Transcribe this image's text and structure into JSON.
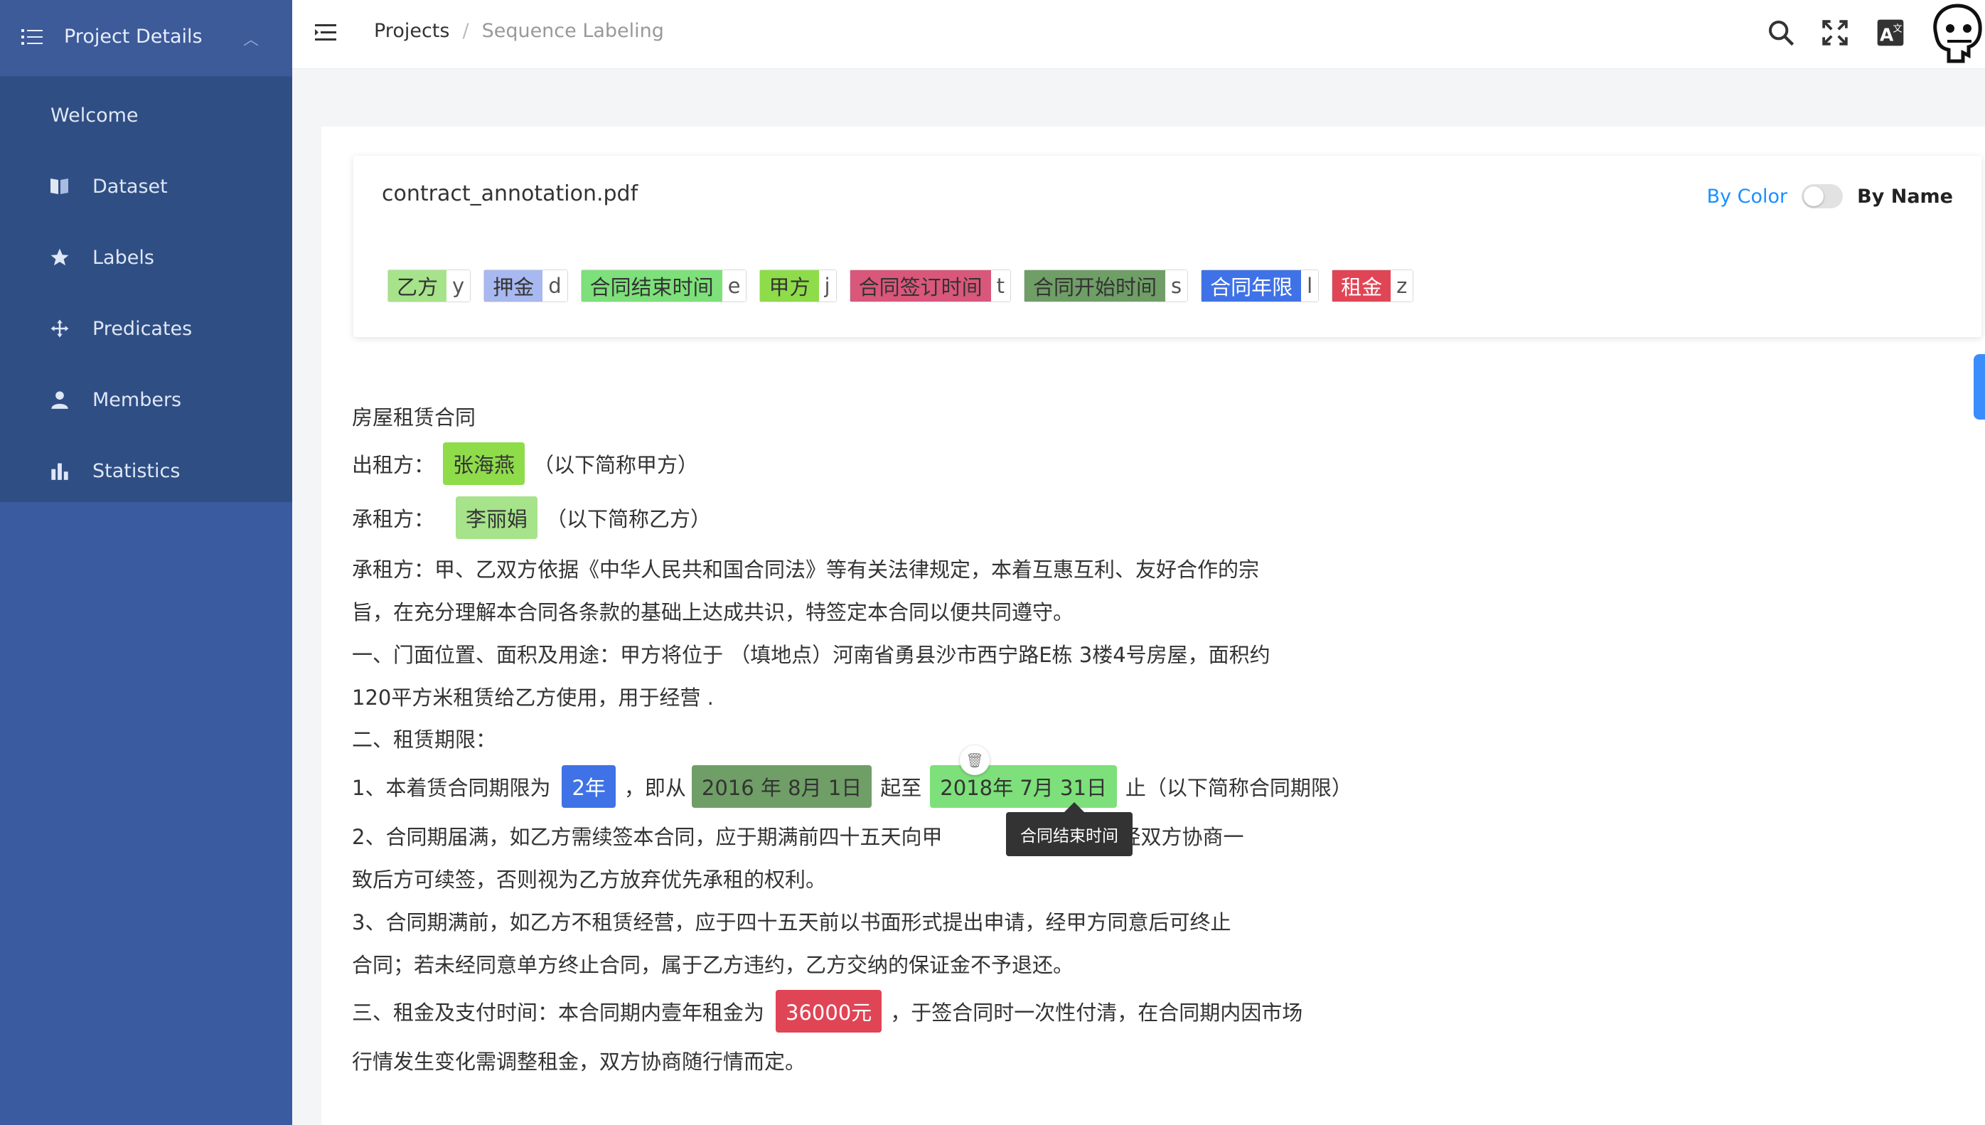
{
  "sidebar": {
    "title": "Project Details",
    "items": [
      {
        "label": "Welcome"
      },
      {
        "label": "Dataset"
      },
      {
        "label": "Labels"
      },
      {
        "label": "Predicates"
      },
      {
        "label": "Members"
      },
      {
        "label": "Statistics"
      }
    ]
  },
  "header": {
    "breadcrumb": [
      "Projects",
      "/",
      "Sequence Labeling"
    ]
  },
  "labels_card": {
    "filename": "contract_annotation.pdf",
    "toggle_left": "By Color",
    "toggle_right": "By Name",
    "labels": [
      {
        "name": "乙方",
        "key": "y",
        "color": "#a6e38a"
      },
      {
        "name": "押金",
        "key": "d",
        "color": "#a8b8f0"
      },
      {
        "name": "合同结束时间",
        "key": "e",
        "color": "#7de07a"
      },
      {
        "name": "甲方",
        "key": "j",
        "color": "#8fdc4a"
      },
      {
        "name": "合同签订时间",
        "key": "t",
        "color": "#d9577a"
      },
      {
        "name": "合同开始时间",
        "key": "s",
        "color": "#6f9e66"
      },
      {
        "name": "合同年限",
        "key": "l",
        "color": "#3f72e6"
      },
      {
        "name": "租金",
        "key": "z",
        "color": "#e04556"
      }
    ]
  },
  "doc": {
    "l1": "房屋租赁合同",
    "l2a": "出租方：",
    "l2e": "张海燕",
    "l2b": "（以下简称甲方）",
    "l3a": "承租方：",
    "l3e": "李丽娟",
    "l3b": "（以下简称乙方）",
    "l4": "承租方：甲、乙双方依据《中华人民共和国合同法》等有关法律规定，本着互惠互利、友好合作的宗",
    "l5": "旨，在充分理解本合同各条款的基础上达成共识，特签定本合同以便共同遵守。",
    "l6": "一、门面位置、面积及用途：甲方将位于 （填地点）河南省勇县沙市西宁路E栋 3楼4号房屋，面积约",
    "l7": "120平方米租赁给乙方使用，用于经营 .",
    "l8": "二、租赁期限：",
    "l9a": "1、本着赁合同期限为",
    "l9e1": "2年",
    "l9b": "，即从",
    "l9e2": "2016 年 8月 1日",
    "l9c": "起至",
    "l9e3": "2018年 7月 31日",
    "l9d": "止（以下简称合同期限）",
    "l10a": "2、合同期届满，如乙方需续签本合同，应于期满前四十五天向甲",
    "l10b": "求，经双方协商一",
    "l11": "致后方可续签，否则视为乙方放弃优先承租的权利。",
    "l12": "3、合同期满前，如乙方不租赁经营，应于四十五天前以书面形式提出申请，经甲方同意后可终止",
    "l13": "合同；若未经同意单方终止合同，属于乙方违约，乙方交纳的保证金不予退还。",
    "l14a": "三、租金及支付时间：本合同期内壹年租金为",
    "l14e": "36000元",
    "l14b": "，于签合同时一次性付清，在合同期内因市场",
    "l15": "行情发生变化需调整租金，双方协商随行情而定。",
    "tooltip": "合同结束时间"
  },
  "icons": {
    "menu": "list-icon",
    "fold": "menu-fold-icon",
    "search": "search-icon",
    "fullscreen": "fullscreen-icon",
    "translate": "translate-icon",
    "trash": "trash-icon"
  },
  "colors": {
    "sidebar_bg": "#3a5ba0",
    "sidebar_panel": "#2f4e84",
    "accent": "#1890ff"
  }
}
